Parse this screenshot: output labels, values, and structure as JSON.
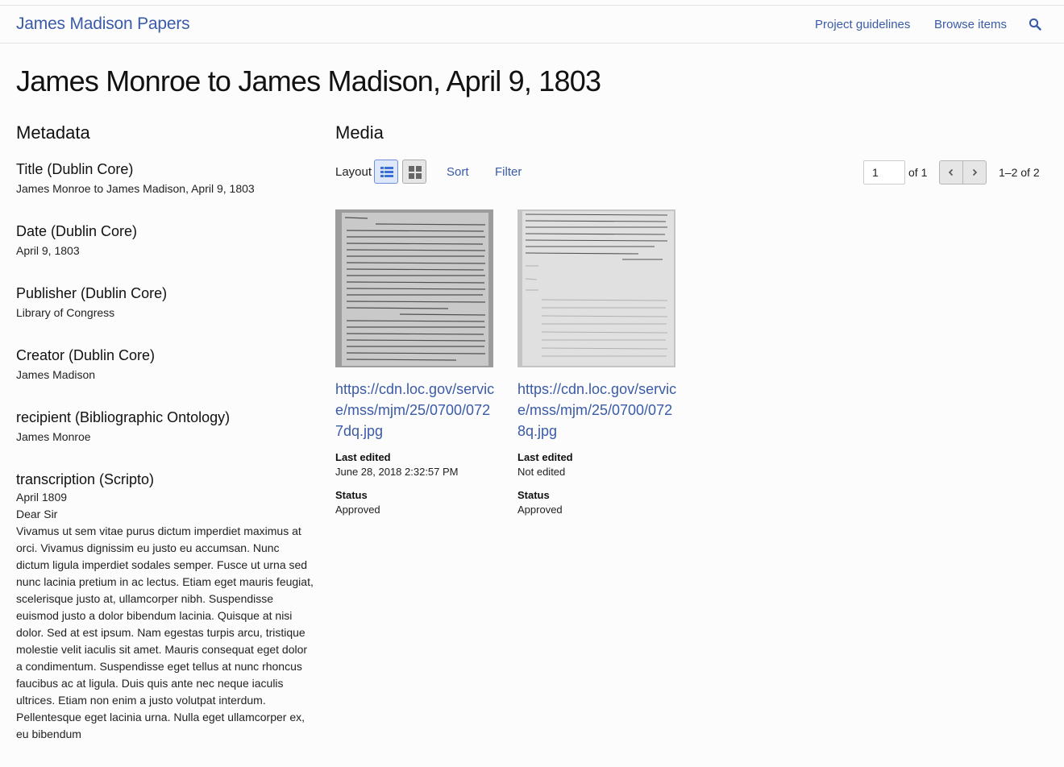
{
  "header": {
    "brand": "James Madison Papers",
    "nav": [
      "Project guidelines",
      "Browse items"
    ]
  },
  "page_title": "James Monroe to James Madison, April 9, 1803",
  "metadata": {
    "heading": "Metadata",
    "fields": [
      {
        "label": "Title (Dublin Core)",
        "value": "James Monroe to James Madison, April 9, 1803"
      },
      {
        "label": "Date (Dublin Core)",
        "value": "April 9, 1803"
      },
      {
        "label": "Publisher (Dublin Core)",
        "value": "Library of Congress"
      },
      {
        "label": "Creator (Dublin Core)",
        "value": "James Madison"
      },
      {
        "label": "recipient (Bibliographic Ontology)",
        "value": "James Monroe"
      }
    ],
    "transcription": {
      "label": "transcription (Scripto)",
      "lines": [
        "April 1809",
        "Dear Sir",
        "Vivamus ut sem vitae purus dictum imperdiet maximus at orci. Vivamus dignissim eu justo eu accumsan. Nunc dictum ligula imperdiet sodales semper. Fusce ut urna sed nunc lacinia pretium in ac lectus. Etiam eget mauris feugiat, scelerisque justo at, ullamcorper nibh. Suspendisse euismod justo a dolor bibendum lacinia. Quisque at nisi dolor. Sed at est ipsum. Nam egestas turpis arcu, tristique molestie velit iaculis sit amet. Mauris consequat eget dolor a condimentum. Suspendisse eget tellus at nunc rhoncus faucibus ac at ligula. Duis quis ante nec neque iaculis ultrices. Etiam non enim a justo volutpat interdum. Pellentesque eget lacinia urna. Nulla eget ullamcorper ex, eu bibendum"
      ]
    }
  },
  "media": {
    "heading": "Media",
    "toolbar": {
      "layout_label": "Layout",
      "sort_label": "Sort",
      "filter_label": "Filter",
      "page_value": "1",
      "of_label": "of 1",
      "range_label": "1–2 of 2"
    },
    "items": [
      {
        "link": "https://cdn.loc.gov/service/mss/mjm/25/0700/0727dq.jpg",
        "last_edited_label": "Last edited",
        "last_edited_value": "June 28, 2018 2:32:57 PM",
        "status_label": "Status",
        "status_value": "Approved"
      },
      {
        "link": "https://cdn.loc.gov/service/mss/mjm/25/0700/0728q.jpg",
        "last_edited_label": "Last edited",
        "last_edited_value": "Not edited",
        "status_label": "Status",
        "status_value": "Approved"
      }
    ]
  },
  "icons": [
    "search-icon",
    "list-layout-icon",
    "grid-layout-icon",
    "chevron-left-icon",
    "chevron-right-icon"
  ],
  "colors": {
    "link": "#3a5ba8",
    "active_button": "#dfe8fb"
  }
}
